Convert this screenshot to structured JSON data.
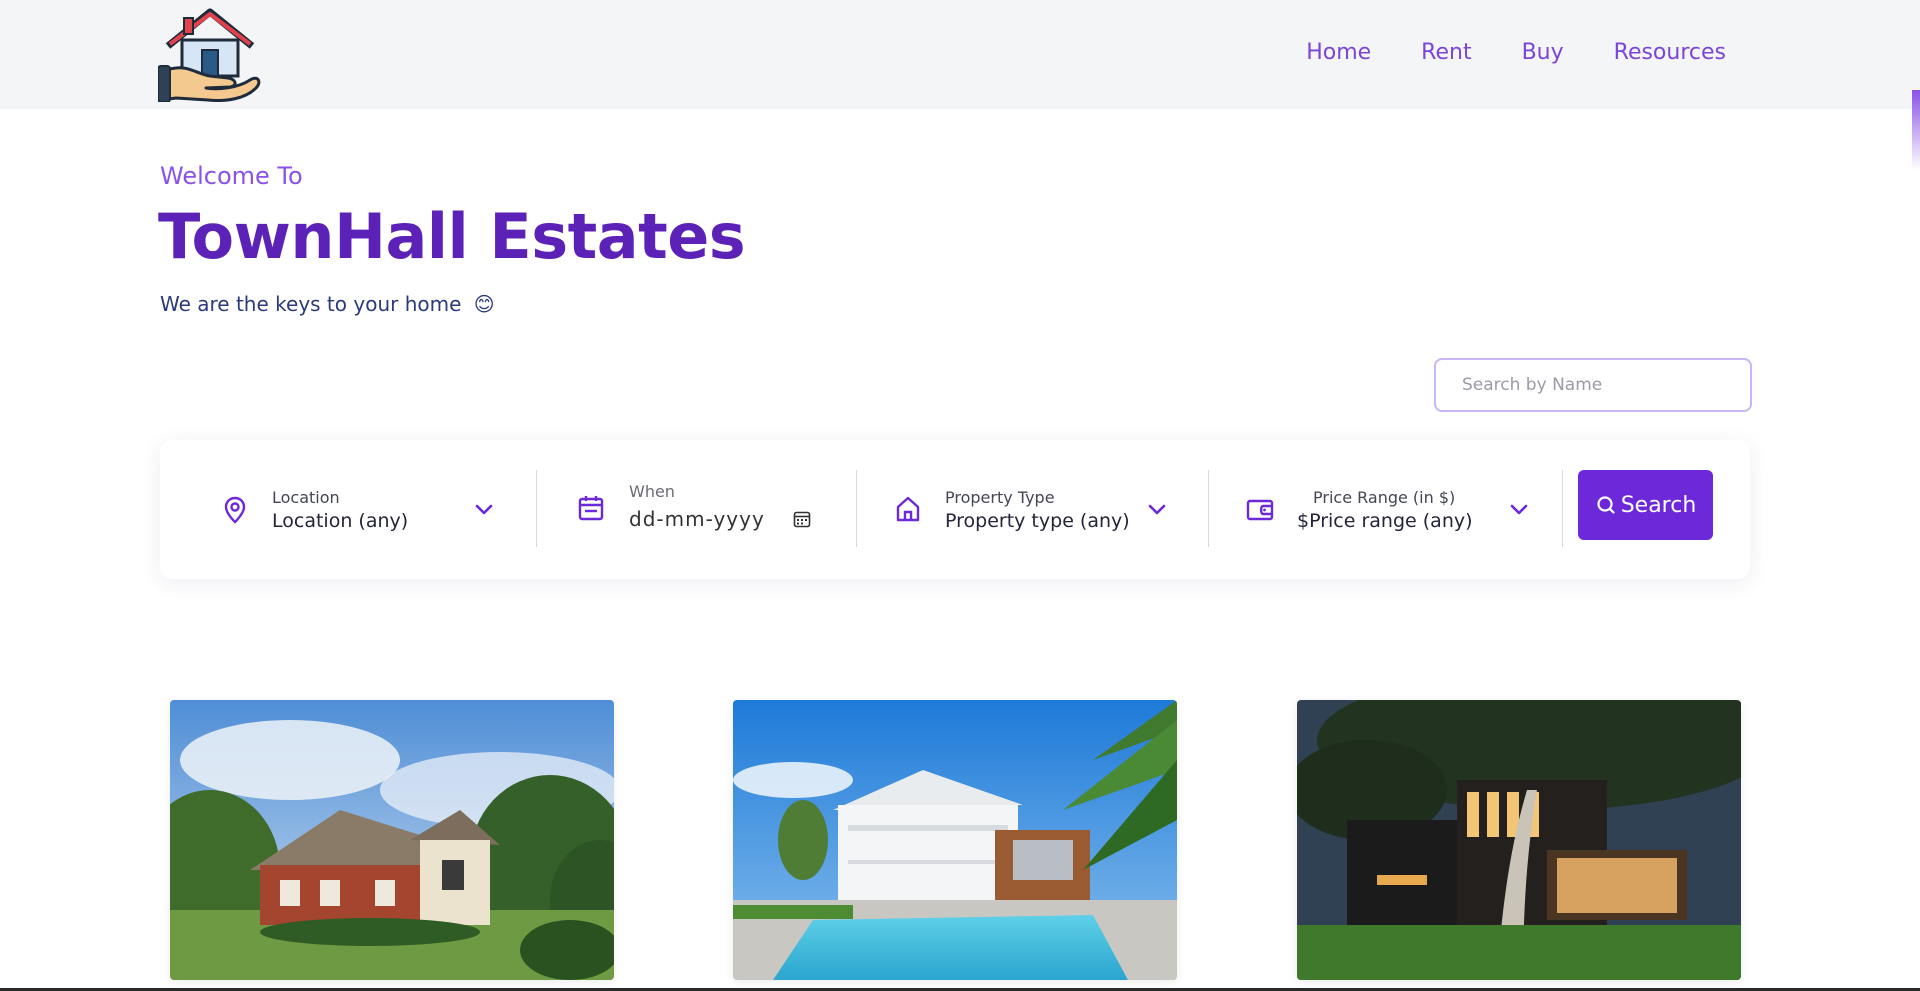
{
  "header": {
    "logo_icon": "house-in-hand-icon",
    "nav": [
      "Home",
      "Rent",
      "Buy",
      "Resources"
    ]
  },
  "hero": {
    "welcome": "Welcome To",
    "title": "TownHall Estates",
    "tagline": "We are the keys to your home",
    "tagline_emoji": "😊"
  },
  "search": {
    "placeholder": "Search by Name"
  },
  "filters": {
    "location": {
      "icon": "map-pin-icon",
      "label": "Location",
      "value": "Location (any)"
    },
    "when": {
      "icon": "calendar-icon",
      "label": "When",
      "value": "dd-mm-yyyy"
    },
    "property_type": {
      "icon": "house-icon",
      "label": "Property Type",
      "value": "Property type (any)"
    },
    "price": {
      "icon": "wallet-icon",
      "label": "Price Range (in $)",
      "value": "$Price range (any)"
    },
    "search_button": "Search"
  },
  "cards": [
    {
      "image": "brick-suburban-house-photo"
    },
    {
      "image": "white-house-with-pool-photo"
    },
    {
      "image": "modern-dark-house-at-dusk-photo"
    }
  ],
  "colors": {
    "accent": "#6d28d9",
    "title": "#5c22b8",
    "nav": "#7b45d6",
    "header_bg": "#f4f5f7"
  }
}
